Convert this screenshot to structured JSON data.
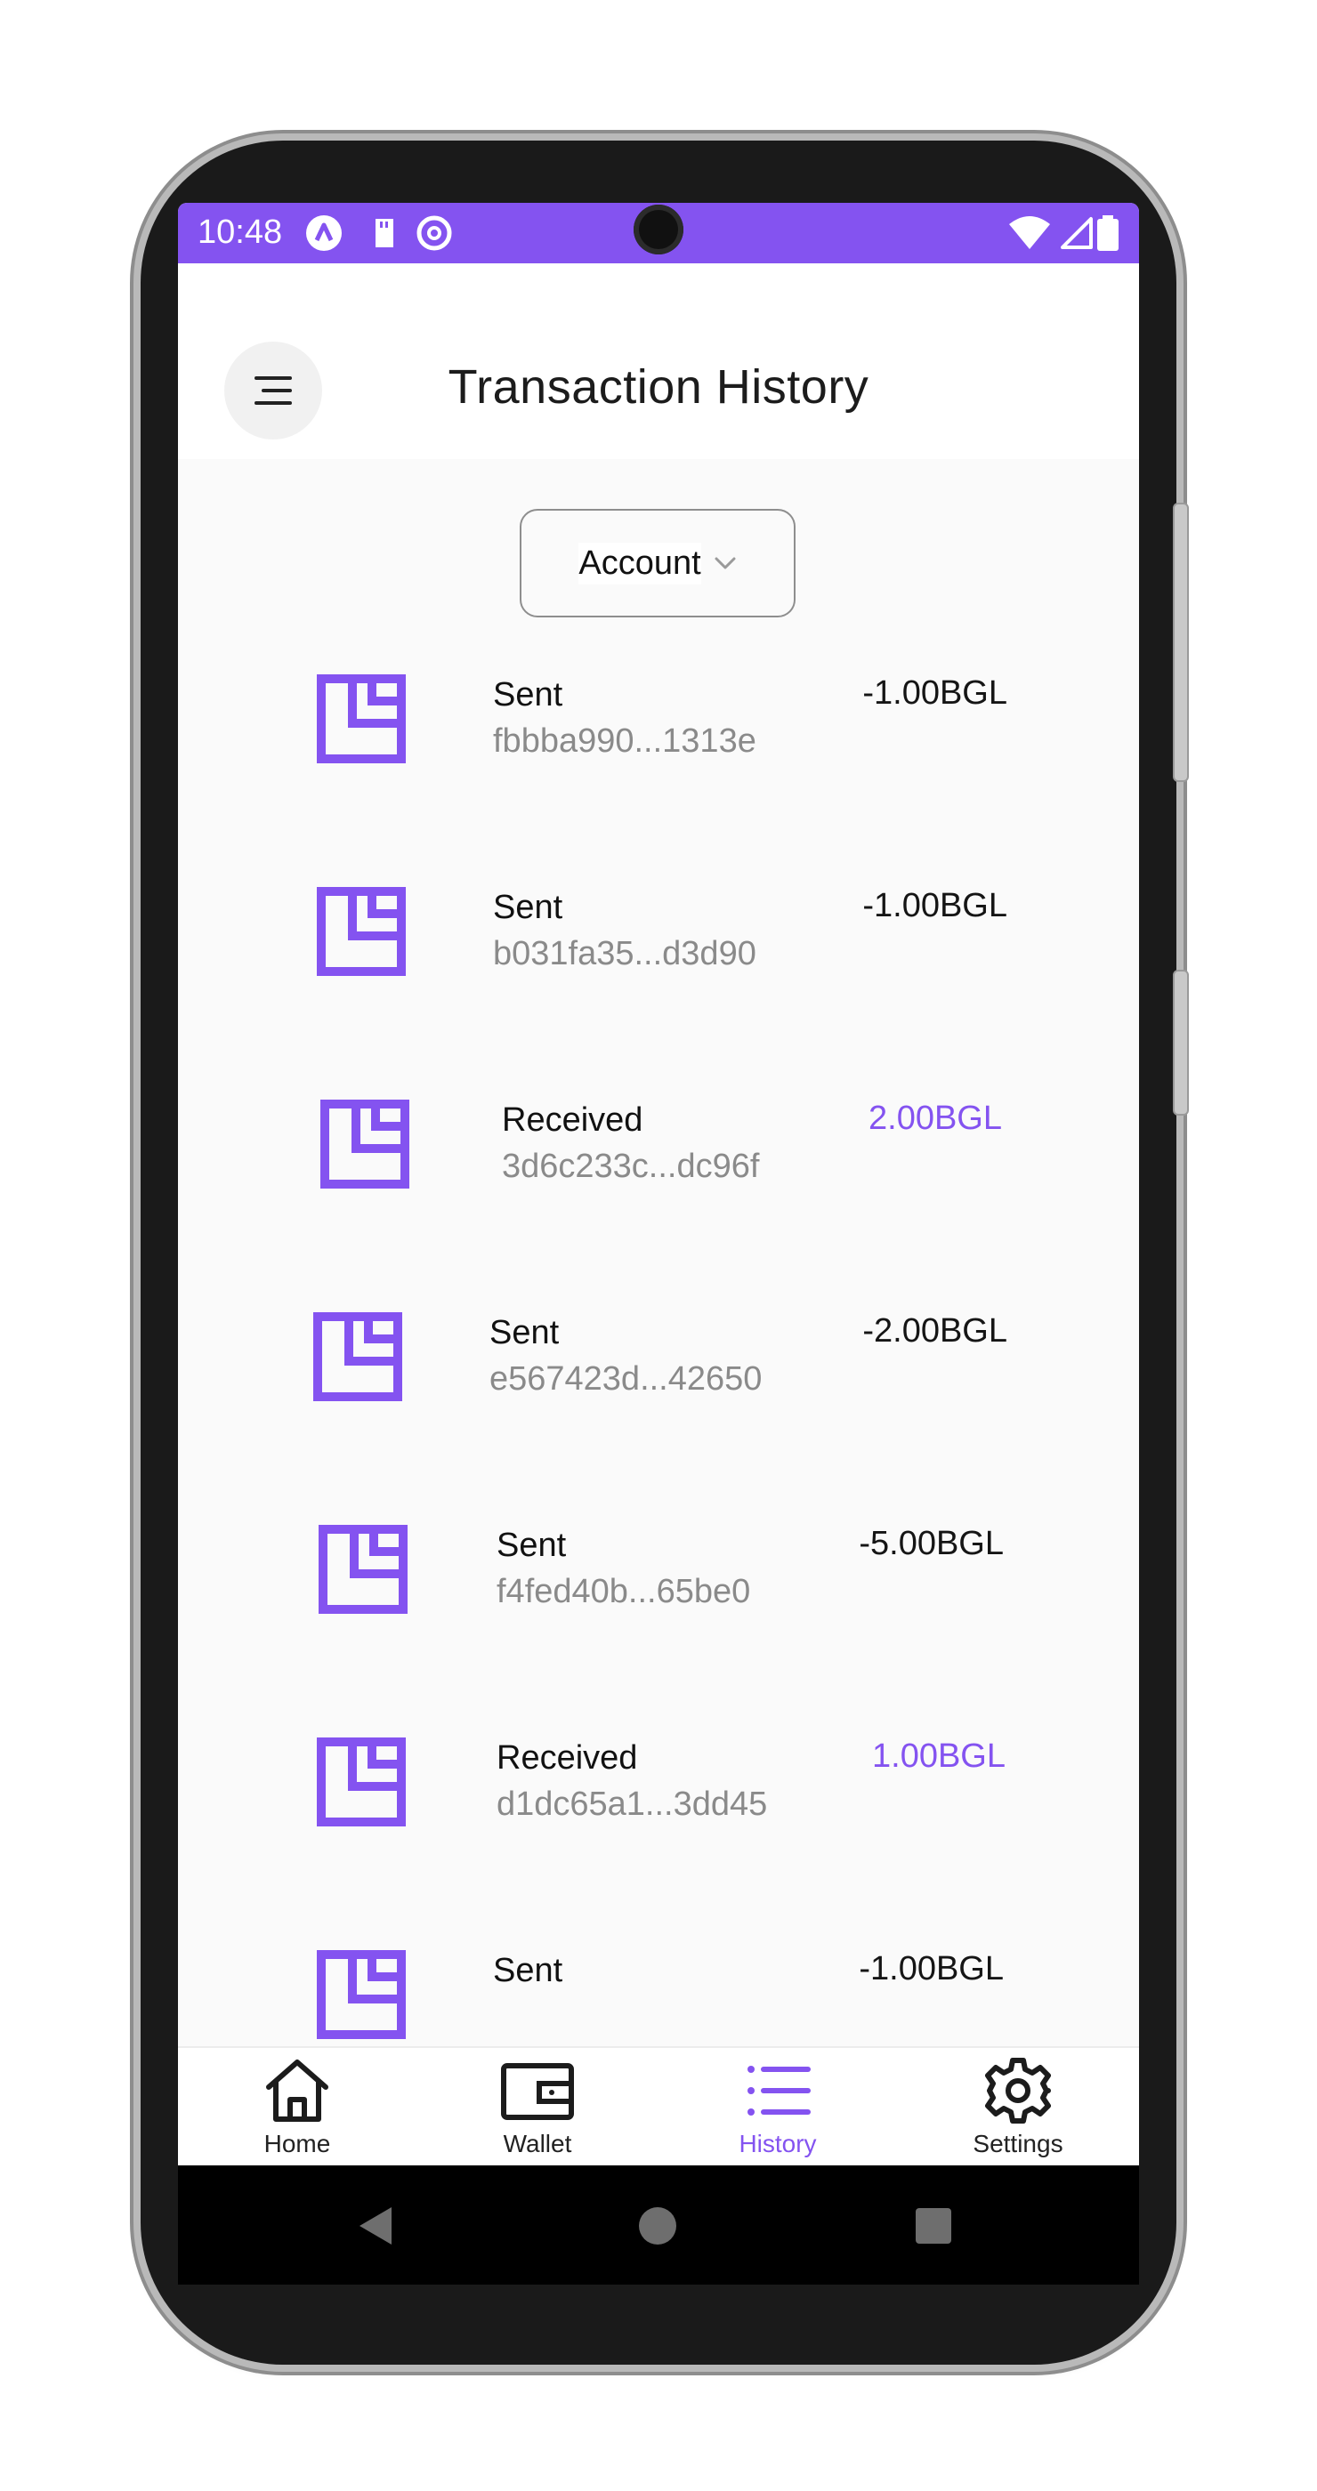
{
  "status_bar": {
    "time": "10:48",
    "icons_left": [
      "app-logo-icon",
      "sd-card-icon",
      "at-sign-icon"
    ],
    "icons_right": [
      "wifi-icon",
      "signal-icon",
      "battery-icon"
    ],
    "color": "#8453f0"
  },
  "header": {
    "title": "Transaction History",
    "menu_icon": "menu-icon"
  },
  "filter": {
    "label": "Account",
    "icon": "chevron-down-icon"
  },
  "transactions": [
    {
      "type": "Sent",
      "hash": "fbbba990...1313e",
      "amount": "-1.00BGL",
      "direction": "sent"
    },
    {
      "type": "Sent",
      "hash": "b031fa35...d3d90",
      "amount": "-1.00BGL",
      "direction": "sent"
    },
    {
      "type": "Received",
      "hash": "3d6c233c...dc96f",
      "amount": "2.00BGL",
      "direction": "received"
    },
    {
      "type": "Sent",
      "hash": "e567423d...42650",
      "amount": "-2.00BGL",
      "direction": "sent"
    },
    {
      "type": "Sent",
      "hash": "f4fed40b...65be0",
      "amount": "-5.00BGL",
      "direction": "sent"
    },
    {
      "type": "Received",
      "hash": "d1dc65a1...3dd45",
      "amount": "1.00BGL",
      "direction": "received"
    },
    {
      "type": "Sent",
      "hash": "",
      "amount": "-1.00BGL",
      "direction": "sent"
    }
  ],
  "bottom_nav": {
    "items": [
      {
        "label": "Home",
        "icon": "home-icon"
      },
      {
        "label": "Wallet",
        "icon": "wallet-icon"
      },
      {
        "label": "History",
        "icon": "list-icon",
        "active": true
      },
      {
        "label": "Settings",
        "icon": "gear-icon"
      }
    ]
  },
  "colors": {
    "accent": "#8453f0",
    "text_primary": "#111111",
    "text_secondary": "#8a8a8a"
  }
}
